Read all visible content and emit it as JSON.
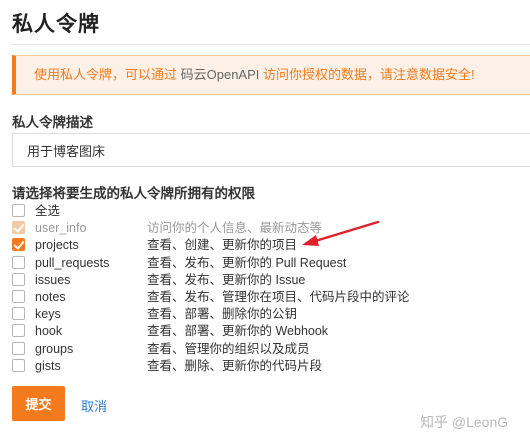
{
  "page": {
    "title": "私人令牌"
  },
  "alert": {
    "text_before": "使用私人令牌，可以通过 ",
    "highlight": "码云OpenAPI",
    "text_after": " 访问你授权的数据，请注意数据安全!"
  },
  "description": {
    "label": "私人令牌描述",
    "value": "用于博客图床"
  },
  "permissions": {
    "label": "请选择将要生成的私人令牌所拥有的权限",
    "select_all": {
      "label": "全选",
      "checked": false
    },
    "items": [
      {
        "name": "user_info",
        "desc": "访问你的个人信息、最新动态等",
        "checked": true,
        "disabled": true
      },
      {
        "name": "projects",
        "desc": "查看、创建、更新你的项目",
        "checked": true,
        "disabled": false
      },
      {
        "name": "pull_requests",
        "desc": "查看、发布、更新你的 Pull Request",
        "checked": false,
        "disabled": false
      },
      {
        "name": "issues",
        "desc": "查看、发布、更新你的 Issue",
        "checked": false,
        "disabled": false
      },
      {
        "name": "notes",
        "desc": "查看、发布、管理你在项目、代码片段中的评论",
        "checked": false,
        "disabled": false
      },
      {
        "name": "keys",
        "desc": "查看、部署、删除你的公钥",
        "checked": false,
        "disabled": false
      },
      {
        "name": "hook",
        "desc": "查看、部署、更新你的 Webhook",
        "checked": false,
        "disabled": false
      },
      {
        "name": "groups",
        "desc": "查看、管理你的组织以及成员",
        "checked": false,
        "disabled": false
      },
      {
        "name": "gists",
        "desc": "查看、删除、更新你的代码片段",
        "checked": false,
        "disabled": false
      }
    ]
  },
  "actions": {
    "submit": "提交",
    "cancel": "取消"
  },
  "watermark": "知乎 @LeonG",
  "colors": {
    "accent": "#f37b1d",
    "link": "#2c7bd0",
    "annotation_arrow": "#e0202a"
  }
}
